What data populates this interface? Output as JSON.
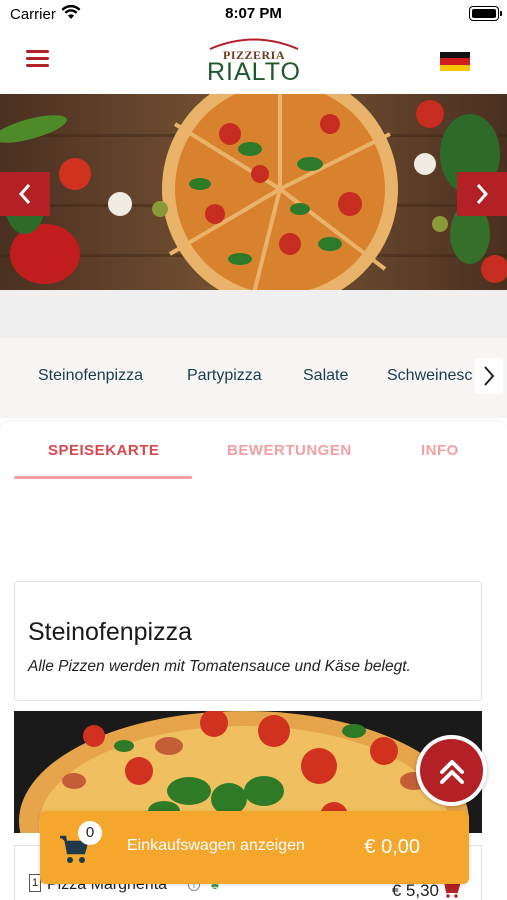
{
  "status_bar": {
    "carrier": "Carrier",
    "time": "8:07 PM"
  },
  "header": {
    "logo_top": "PIZZERIA",
    "logo_main": "RIALTO",
    "menu_icon": "hamburger-menu-icon",
    "language_flag": "german-flag-icon",
    "colors": {
      "brand_red": "#b32025",
      "logo_green": "#1d5a2a"
    }
  },
  "hero": {
    "prev_icon": "chevron-left-icon",
    "next_icon": "chevron-right-icon"
  },
  "categories": [
    "Steinofenpizza",
    "Partypizza",
    "Salate",
    "Schweinesc"
  ],
  "tabs": [
    {
      "label": "SPEISEKARTE",
      "active": true
    },
    {
      "label": "BEWERTUNGEN",
      "active": false
    },
    {
      "label": "INFO",
      "active": false
    }
  ],
  "section": {
    "title": "Steinofenpizza",
    "description": "Alle Pizzen werden mit Tomatensauce und Käse belegt."
  },
  "item": {
    "number": "1",
    "name": "Pizza Margherita",
    "price": "€ 5,30"
  },
  "cart": {
    "count": "0",
    "label": "Einkaufswagen anzeigen",
    "total": "€ 0,00",
    "color": "#f4a62d"
  }
}
